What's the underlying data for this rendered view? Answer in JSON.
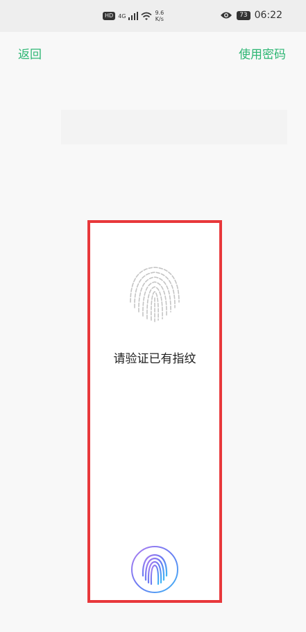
{
  "status_bar": {
    "hd": "HD",
    "signal": "4G",
    "speed_value": "9.6",
    "speed_unit": "K/s",
    "battery": "73",
    "time": "06:22"
  },
  "nav": {
    "back_label": "返回",
    "use_password_label": "使用密码"
  },
  "dialog": {
    "prompt": "请验证已有指纹"
  },
  "colors": {
    "accent": "#2db673",
    "highlight": "#e8383b"
  }
}
